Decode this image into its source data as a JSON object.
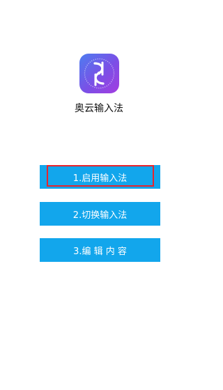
{
  "app": {
    "name": "奥云输入法",
    "icon": "quill-pen-logo-icon",
    "icon_gradient": [
      "#4d7df0",
      "#7b4fe6",
      "#a33de0"
    ]
  },
  "buttons": [
    {
      "label": "1.启用输入法",
      "highlighted": true
    },
    {
      "label": "2.切换输入法",
      "highlighted": false
    },
    {
      "label": "3.编 辑 内 容",
      "highlighted": false
    }
  ],
  "colors": {
    "button_bg": "#12a6ec",
    "button_text": "#ffffff",
    "highlight_border": "#e8242c",
    "background": "#ffffff"
  }
}
